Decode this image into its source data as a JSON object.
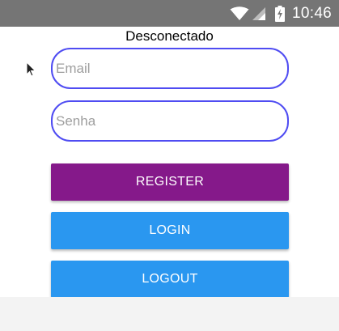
{
  "status_bar": {
    "time": "10:46",
    "icons": [
      "wifi-icon",
      "signal-icon",
      "battery-charging-icon"
    ],
    "background": "#757575"
  },
  "page": {
    "title": "Desconectado"
  },
  "form": {
    "email_placeholder": "Email",
    "password_placeholder": "Senha",
    "email_value": "",
    "password_value": ""
  },
  "buttons": {
    "register_label": "REGISTER",
    "login_label": "LOGIN",
    "logout_label": "LOGOUT"
  },
  "colors": {
    "register": "#85198a",
    "login": "#2a97f0",
    "logout": "#2a97f0",
    "input_border": "#4f4cf2"
  }
}
